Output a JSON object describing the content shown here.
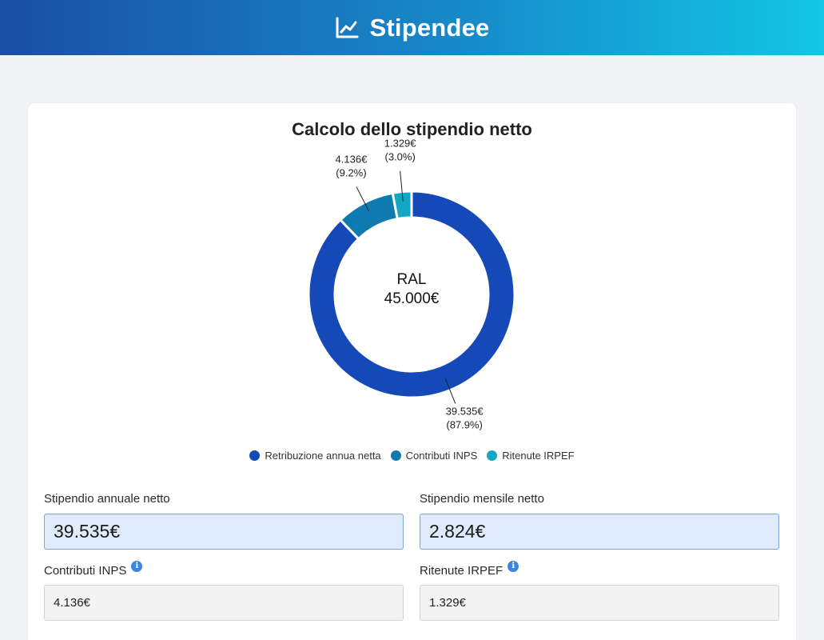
{
  "header": {
    "title": "Stipendee",
    "icon": "line-chart-icon"
  },
  "chart_title": "Calcolo dello stipendio netto",
  "center": {
    "label": "RAL",
    "value": "45.000€"
  },
  "chart_data": {
    "type": "pie",
    "title": "Calcolo dello stipendio netto",
    "center_text": [
      "RAL",
      "45.000€"
    ],
    "categories": [
      "Retribuzione annua netta",
      "Contributi INPS",
      "Ritenute IRPEF"
    ],
    "values": [
      39535,
      4136,
      1329
    ],
    "percent": [
      87.9,
      9.2,
      3.0
    ],
    "colors": [
      "#1549b8",
      "#0f7aaf",
      "#12a7c2"
    ],
    "label_values": [
      "39.535€",
      "4.136€",
      "1.329€"
    ],
    "label_percents": [
      "(87.9%)",
      "(9.2%)",
      "(3.0%)"
    ],
    "legend_position": "bottom"
  },
  "fields": {
    "annual_net": {
      "label": "Stipendio annuale netto",
      "value": "39.535€"
    },
    "monthly_net": {
      "label": "Stipendio mensile netto",
      "value": "2.824€"
    },
    "inps": {
      "label": "Contributi INPS",
      "value": "4.136€",
      "icon": "info-icon"
    },
    "irpef": {
      "label": "Ritenute IRPEF",
      "value": "1.329€",
      "icon": "info-icon"
    }
  }
}
